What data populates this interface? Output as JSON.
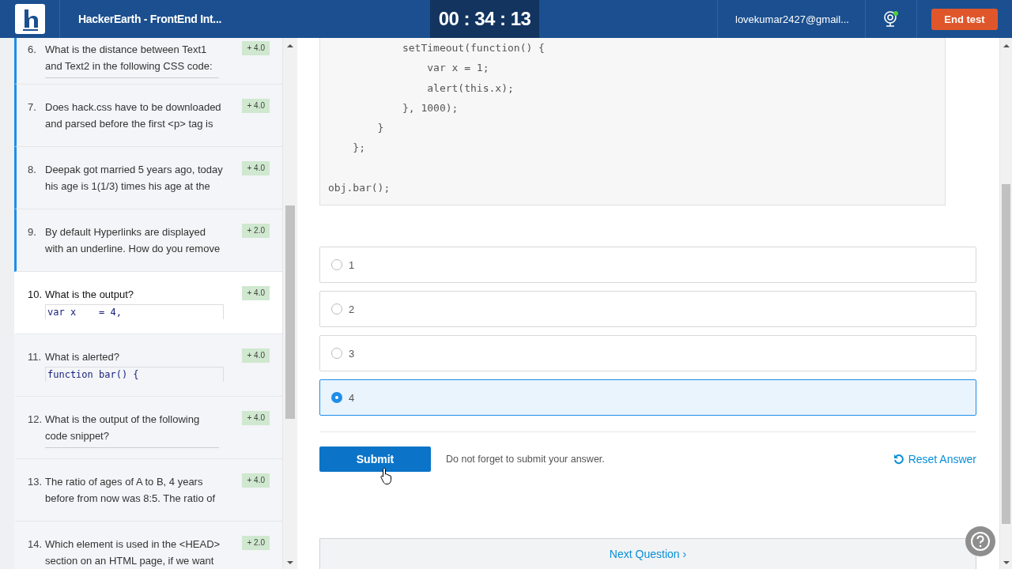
{
  "header": {
    "title": "HackerEarth - FrontEnd Int...",
    "timer": "00 : 34 : 13",
    "user": "lovekumar2427@gmail...",
    "end_button": "End test"
  },
  "questions": [
    {
      "number": "6.",
      "text": "What is the distance between Text1 and Text2 in the following CSS code:",
      "score": "+ 4.0",
      "attempted": true,
      "selected": false,
      "kind": "rule"
    },
    {
      "number": "7.",
      "text": "Does hack.css have to be downloaded and parsed before the first <p> tag is",
      "score": "+ 4.0",
      "attempted": true,
      "selected": false,
      "kind": "text"
    },
    {
      "number": "8.",
      "text": "Deepak got married 5 years ago, today his age is 1(1/3) times his age at the",
      "score": "+ 4.0",
      "attempted": true,
      "selected": false,
      "kind": "text"
    },
    {
      "number": "9.",
      "text": "By default Hyperlinks are displayed with an underline. How do you remove",
      "score": "+ 2.0",
      "attempted": true,
      "selected": false,
      "kind": "text"
    },
    {
      "number": "10.",
      "text": "What is the output?",
      "code": "var x    = 4,",
      "score": "+ 4.0",
      "attempted": false,
      "selected": true,
      "kind": "code"
    },
    {
      "number": "11.",
      "text": "What is alerted?",
      "code": "function bar() {",
      "score": "+ 4.0",
      "attempted": false,
      "selected": false,
      "kind": "code"
    },
    {
      "number": "12.",
      "text": "What is the output of the following code snippet?",
      "score": "+ 4.0",
      "attempted": false,
      "selected": false,
      "kind": "rule"
    },
    {
      "number": "13.",
      "text": "The ratio of ages of A to B, 4 years before from now was 8:5. The ratio of",
      "score": "+ 4.0",
      "attempted": false,
      "selected": false,
      "kind": "text"
    },
    {
      "number": "14.",
      "text": "Which element is used in the <HEAD> section on an HTML page, if we want",
      "score": "+ 2.0",
      "attempted": false,
      "selected": false,
      "kind": "text"
    }
  ],
  "code": "            setTimeout(function() {\n                var x = 1;\n                alert(this.x);\n            }, 1000);\n        }\n    };\n\nobj.bar();",
  "options": [
    {
      "label": "1",
      "selected": false
    },
    {
      "label": "2",
      "selected": false
    },
    {
      "label": "3",
      "selected": false
    },
    {
      "label": "4",
      "selected": true
    }
  ],
  "submit": "Submit",
  "note": "Do not forget to submit your answer.",
  "reset": "Reset Answer",
  "next": "Next Question ›"
}
